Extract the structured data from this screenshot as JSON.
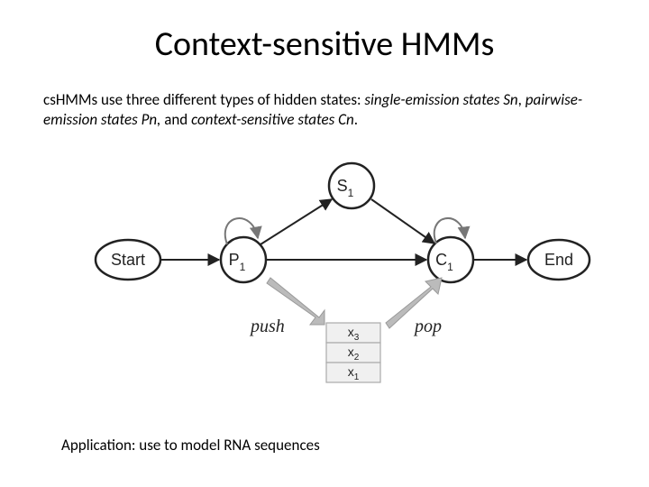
{
  "title": "Context-sensitive HMMs",
  "desc": {
    "p1a": "csHMMs use three different types of hidden states: ",
    "p1b": "single-emission states Sn",
    "p1c": ", ",
    "p1d": "pairwise-emission states Pn, ",
    "p1e": "and ",
    "p1f": "context-sensitive states Cn",
    "p1g": "."
  },
  "nodes": {
    "start": "Start",
    "end": "End",
    "p": "P",
    "p_sub": "1",
    "s": "S",
    "s_sub": "1",
    "c": "C",
    "c_sub": "1"
  },
  "actions": {
    "push": "push",
    "pop": "pop"
  },
  "stack": {
    "x3": "x",
    "x3_sub": "3",
    "x2": "x",
    "x2_sub": "2",
    "x1": "x",
    "x1_sub": "1"
  },
  "application": "Application: use to model RNA sequences"
}
